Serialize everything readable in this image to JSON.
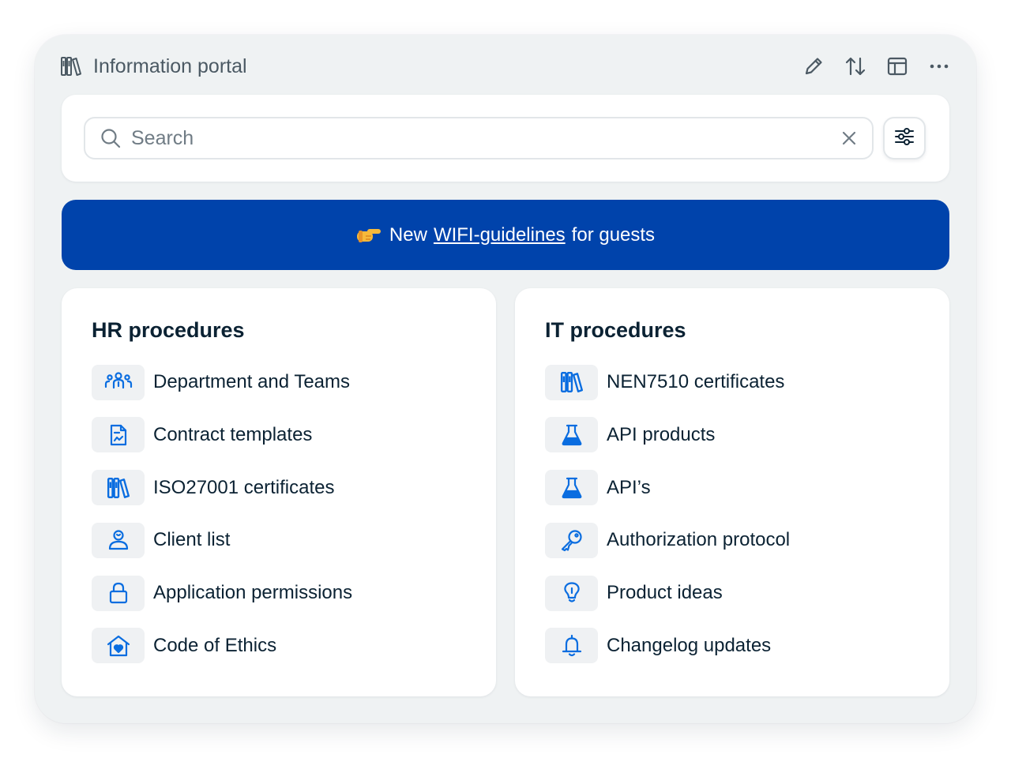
{
  "header": {
    "title": "Information portal",
    "icons": [
      "library-icon",
      "edit-icon",
      "sort-icon",
      "layout-icon",
      "more-icon"
    ]
  },
  "search": {
    "placeholder": "Search",
    "value": ""
  },
  "banner": {
    "emoji": "👉",
    "prefix": "New",
    "link": "WIFI-guidelines",
    "suffix": "for guests",
    "background": "#0043ab"
  },
  "hr": {
    "title": "HR procedures",
    "items": [
      {
        "label": "Department and Teams",
        "icon": "team-icon"
      },
      {
        "label": "Contract templates",
        "icon": "document-icon"
      },
      {
        "label": "ISO27001 certificates",
        "icon": "library-icon"
      },
      {
        "label": "Client list",
        "icon": "user-icon"
      },
      {
        "label": "Application permissions",
        "icon": "lock-icon"
      },
      {
        "label": "Code of Ethics",
        "icon": "home-heart-icon"
      }
    ]
  },
  "it": {
    "title": "IT procedures",
    "items": [
      {
        "label": "NEN7510 certificates",
        "icon": "library-icon"
      },
      {
        "label": "API products",
        "icon": "flask-icon"
      },
      {
        "label": "API’s",
        "icon": "flask-icon"
      },
      {
        "label": "Authorization protocol",
        "icon": "key-icon"
      },
      {
        "label": "Product ideas",
        "icon": "lightbulb-icon"
      },
      {
        "label": "Changelog updates",
        "icon": "bell-icon"
      }
    ]
  },
  "colors": {
    "accent": "#0a6de0",
    "banner": "#0043ab",
    "text": "#0b2233",
    "muted": "#4b5963"
  }
}
